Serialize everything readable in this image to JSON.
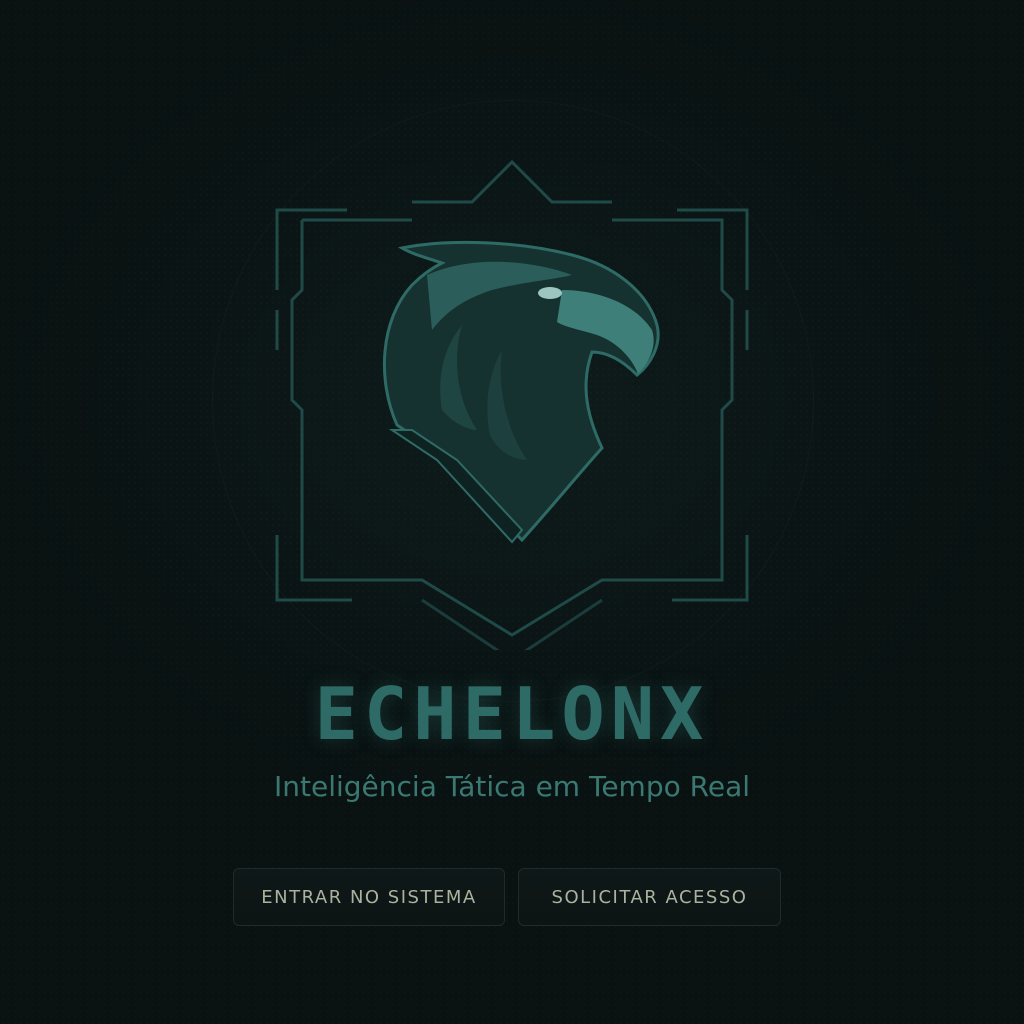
{
  "brand": {
    "name": "ECHELONX",
    "tagline": "Inteligência Tática em Tempo Real"
  },
  "emblem": {
    "icon": "eagle-head-icon",
    "frame": "hexagonal-tech-frame"
  },
  "actions": {
    "enter_label": "ENTRAR NO SISTEMA",
    "request_label": "SOLICITAR ACESSO"
  },
  "colors": {
    "background": "#0a1212",
    "accent": "#2f6b66",
    "tagline": "#3b7872",
    "button_text": "#a9b39f"
  }
}
